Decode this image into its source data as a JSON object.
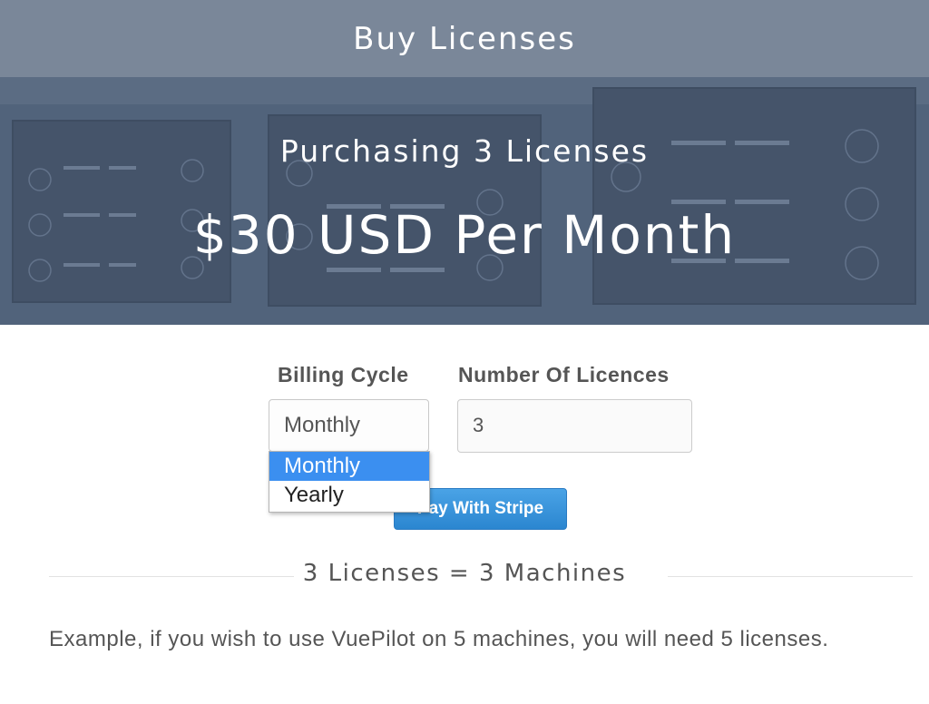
{
  "header": {
    "title": "Buy Licenses"
  },
  "hero": {
    "subtitle": "Purchasing 3 Licenses",
    "price": "$30 USD Per Month"
  },
  "form": {
    "billing_label": "Billing Cycle",
    "billing_value": "Monthly",
    "billing_options": [
      "Monthly",
      "Yearly"
    ],
    "billing_selected_option": "Monthly",
    "licences_label": "Number Of Licences",
    "licences_value": "3",
    "pay_button_label": "Pay With Stripe"
  },
  "divider": {
    "text": "3 Licenses = 3 Machines"
  },
  "example": {
    "text": "Example, if you wish to use VuePilot on 5 machines, you will need 5 licenses."
  },
  "colors": {
    "header_bg": "#7a8799",
    "hero_bg": "#4d5d74",
    "button": "#2b86d0",
    "dropdown_highlight": "#3b8ff0"
  }
}
